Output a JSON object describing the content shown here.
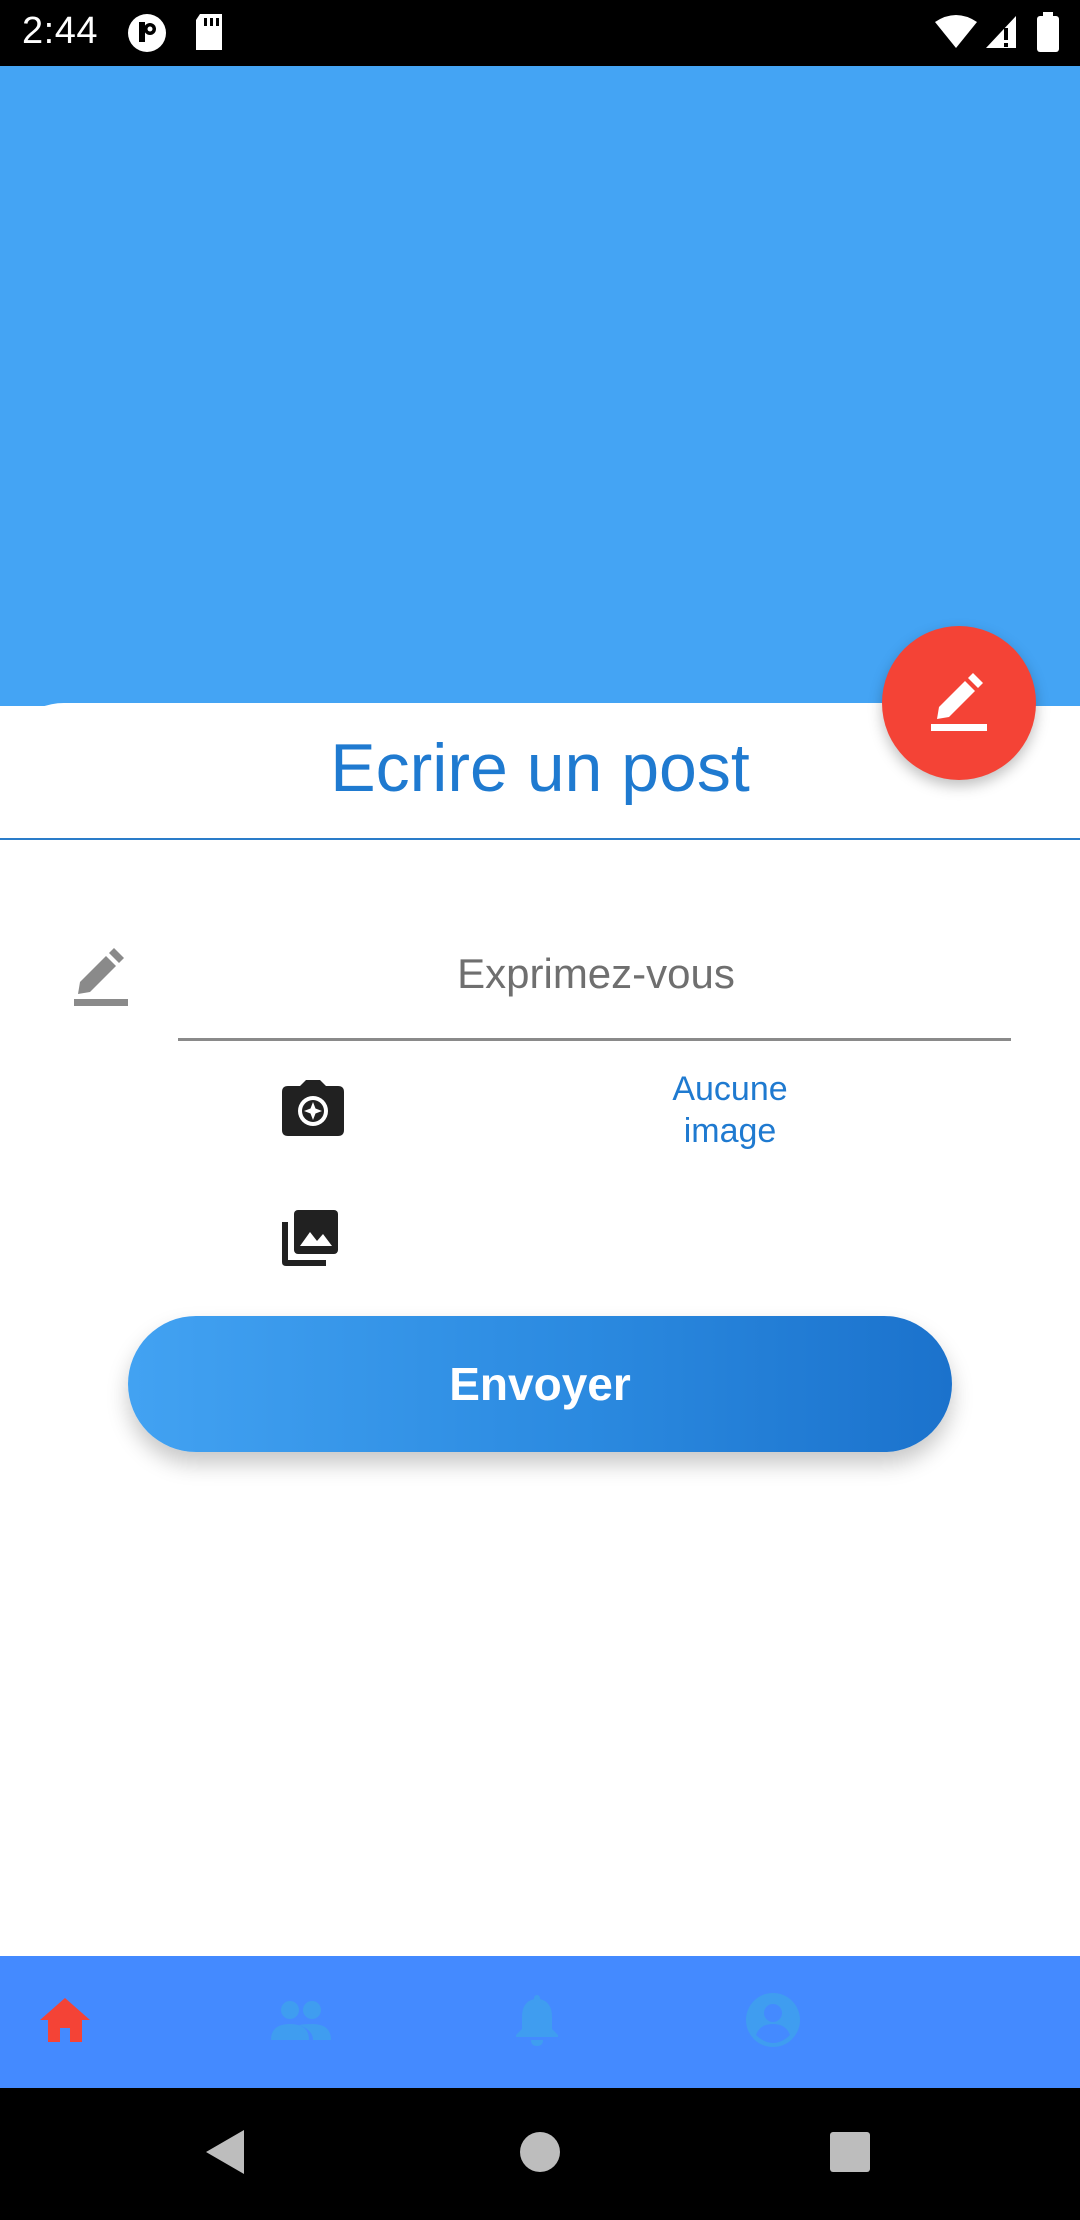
{
  "status_bar": {
    "time": "2:44",
    "icons": [
      "privacy-dot-icon",
      "sd-card-icon",
      "wifi-icon",
      "signal-icon",
      "battery-icon"
    ]
  },
  "sheet": {
    "title": "Ecrire un post"
  },
  "fab": {
    "icon": "edit-icon",
    "color": "#f44336"
  },
  "form": {
    "text_field": {
      "placeholder": "Exprimez-vous",
      "value": "",
      "icon": "edit-icon"
    },
    "camera_icon": "camera-icon",
    "gallery_icon": "photo-library-icon",
    "image_status": "Aucune image",
    "send_label": "Envoyer"
  },
  "bottom_nav": {
    "items": [
      {
        "icon": "home-icon",
        "selected": true,
        "color": "#f44336"
      },
      {
        "icon": "people-icon",
        "selected": false,
        "color": "#3f9df0"
      },
      {
        "icon": "bell-icon",
        "selected": false,
        "color": "#3f9df0"
      },
      {
        "icon": "account-icon",
        "selected": false,
        "color": "#3f9df0"
      }
    ]
  },
  "colors": {
    "header_bg": "#44a4f4",
    "accent_blue": "#1f7ad0",
    "nav_bg": "#448aff"
  }
}
